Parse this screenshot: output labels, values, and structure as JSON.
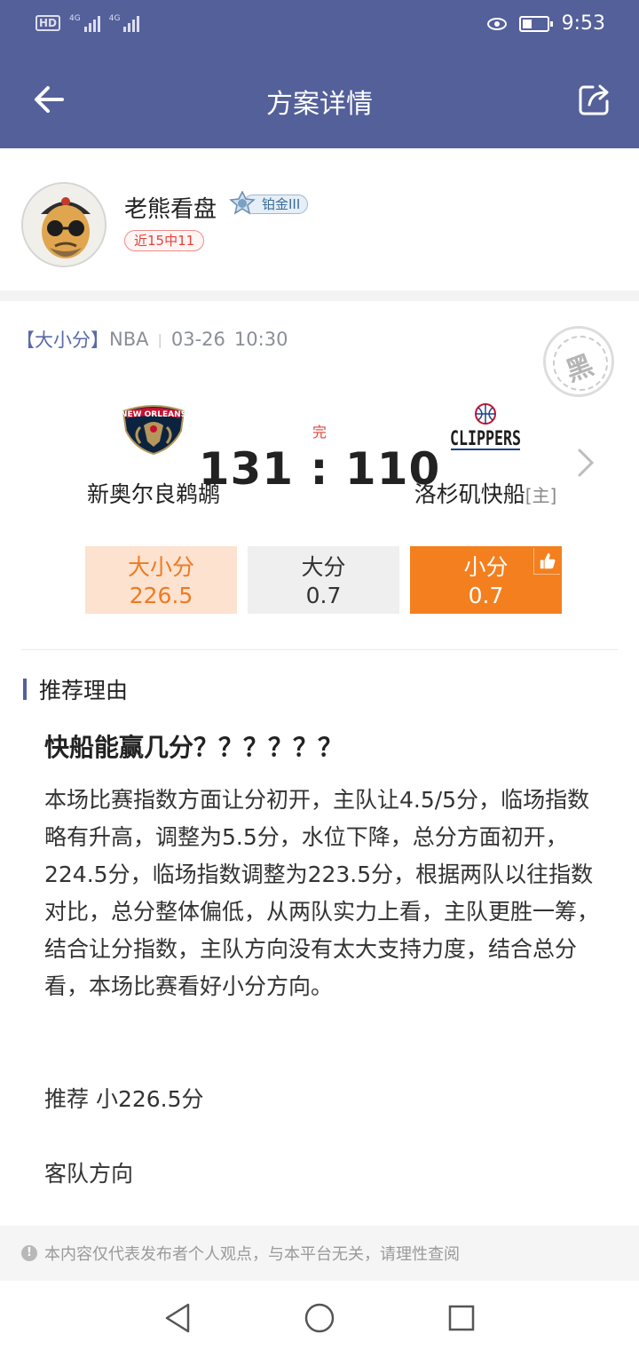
{
  "status_bar": {
    "hd": "HD",
    "net1": "4G",
    "net2": "4G",
    "time": "9:53"
  },
  "header": {
    "title": "方案详情"
  },
  "author": {
    "name": "老熊看盘",
    "rank": "铂金III",
    "record": "近15中11"
  },
  "match": {
    "category": "【大小分】",
    "league": "NBA",
    "date": "03-26",
    "time": "10:30",
    "stamp": "黑",
    "state": "完",
    "score": "131 : 110",
    "home_team": "新奥尔良鹈鹕",
    "away_team": "洛杉矶快船",
    "away_tag": "[主]",
    "odds": {
      "total_label": "大小分",
      "total_value": "226.5",
      "over_label": "大分",
      "over_value": "0.7",
      "under_label": "小分",
      "under_value": "0.7"
    }
  },
  "reason": {
    "heading": "推荐理由",
    "title": "快船能赢几分？？？？？？",
    "body": "本场比赛指数方面让分初开，主队让4.5/5分，临场指数略有升高，调整为5.5分，水位下降，总分方面初开，224.5分，临场指数调整为223.5分，根据两队以往指数对比，总分整体偏低，从两队实力上看，主队更胜一筹，结合让分指数，主队方向没有太大支持力度，结合总分看，本场比赛看好小分方向。",
    "pick": "推荐  小226.5分",
    "direction": "客队方向"
  },
  "disclaimer": "本内容仅代表发布者个人观点，与本平台无关，请理性查阅",
  "icons": [
    "back-arrow-icon",
    "share-icon",
    "rank-badge-icon",
    "chevron-right-icon",
    "thumbs-up-icon",
    "info-icon",
    "nav-back-icon",
    "nav-home-icon",
    "nav-recent-icon"
  ],
  "colors": {
    "header": "#54609a",
    "accent_orange": "#f47f1e",
    "red": "#e2443c"
  }
}
